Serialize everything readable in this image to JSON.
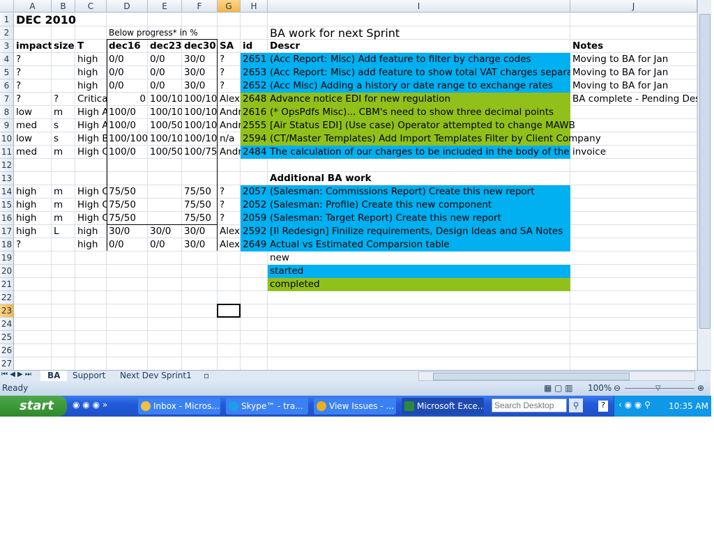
{
  "columns": [
    "A",
    "B",
    "C",
    "D",
    "E",
    "F",
    "G",
    "H",
    "I",
    "J"
  ],
  "selected_cell": "G23",
  "colors": {
    "started": "#00B0F0",
    "completed": "#92C01A",
    "new": "#FFFFFF"
  },
  "rows": {
    "1": {
      "A": "DEC 2010"
    },
    "2": {
      "D": "Below progress* in %",
      "I": "BA work for next Sprint"
    },
    "3": {
      "A": "impact",
      "B": "size",
      "C": "T",
      "D": "dec16",
      "E": "dec23",
      "F": "dec30",
      "G": "SA",
      "H": "id",
      "I": "Descr",
      "J": "Notes"
    },
    "4": {
      "A": "?",
      "C": "high",
      "D": "0/0",
      "E": "0/0",
      "F": "30/0",
      "G": "?",
      "H": "2651",
      "I": "(Acc Report: Misc) Add feature to filter by charge codes",
      "J": "Moving to BA for Jan",
      "status": "started"
    },
    "5": {
      "A": "?",
      "C": "high",
      "D": "0/0",
      "E": "0/0",
      "F": "30/0",
      "G": "?",
      "H": "2653",
      "I": "(Acc Report: Misc) add feature to show total VAT charges separat",
      "J": "Moving to BA for Jan",
      "status": "started"
    },
    "6": {
      "A": "?",
      "C": "high",
      "D": "0/0",
      "E": "0/0",
      "F": "30/0",
      "G": "?",
      "H": "2652",
      "I": "(Acc Misc) Adding a history or date range to exchange rates",
      "J": "Moving to BA for Jan",
      "status": "started"
    },
    "7": {
      "A": "?",
      "B": "?",
      "C": "Critical",
      "D": "0",
      "E": "100/10",
      "F": "100/10",
      "G": "Alex",
      "H": "2648",
      "I": "Advance notice EDI for new regulation",
      "J": "BA complete - Pending Des",
      "status": "completed"
    },
    "8": {
      "A": "low",
      "B": "m",
      "C": "High A",
      "D": "100/0",
      "E": "100/10",
      "F": "100/10",
      "G": "Andr",
      "H": "2616",
      "I": " (* OpsPdfs Misc)... CBM's need to show three decimal points",
      "status": "completed"
    },
    "9": {
      "A": "med",
      "B": "s",
      "C": "High A",
      "D": "100/0",
      "E": "100/50",
      "F": "100/10",
      "G": "Andr",
      "H": "2555",
      "I": "[Air Status EDI] (Use case) Operator attempted to change MAWB",
      "status": "completed"
    },
    "10": {
      "A": "low",
      "B": "s",
      "C": "High B",
      "D": "100/100",
      "E": "100/10",
      "F": "100/10",
      "G": "n/a",
      "H": "2594",
      "I": "(CT/Master Templates) Add Import Templates Filter by Client Company",
      "status": "completed"
    },
    "11": {
      "A": "med",
      "B": "m",
      "C": "High C",
      "D": "100/0",
      "E": "100/50",
      "F": "100/75",
      "G": "Andr",
      "H": "2484",
      "I": "The calculation of our charges to be included in the body of the invoice",
      "status": "started"
    },
    "13": {
      "I": "Additional BA work"
    },
    "14": {
      "A": "high",
      "B": "m",
      "C": "High C",
      "D": "75/50",
      "F": "75/50",
      "G": "?",
      "H": "2057",
      "I": "(Salesman: Commissions Report) Create this new report",
      "status": "started"
    },
    "15": {
      "A": "high",
      "B": "m",
      "C": "High C",
      "D": "75/50",
      "F": "75/50",
      "G": "?",
      "H": "2052",
      "I": "(Salesman: Profile) Create this new component",
      "status": "started"
    },
    "16": {
      "A": "high",
      "B": "m",
      "C": "High C",
      "D": "75/50",
      "F": "75/50",
      "G": "?",
      "H": "2059",
      "I": "(Salesman: Target Report) Create this new report",
      "status": "started"
    },
    "17": {
      "A": "high",
      "B": "L",
      "C": "high",
      "D": "30/0",
      "E": "30/0",
      "F": "30/0",
      "G": "Alex",
      "H": "2592",
      "I": "[II Redesign] Finilize requirements, Design Ideas and SA Notes",
      "status": "started"
    },
    "18": {
      "A": "?",
      "C": "high",
      "D": "0/0",
      "E": "0/0",
      "F": "30/0",
      "G": "Alex",
      "H": "2649",
      "I": "Actual vs Estimated Comparsion table",
      "status": "started"
    },
    "19": {
      "I": "new",
      "legend": "new"
    },
    "20": {
      "I": "started",
      "legend": "started"
    },
    "21": {
      "I": "completed",
      "legend": "completed"
    }
  },
  "sheet_tabs": [
    "BA",
    "Support",
    "Next Dev Sprint1"
  ],
  "active_tab": "BA",
  "status": {
    "ready": "Ready",
    "zoom": "100%"
  },
  "taskbar": {
    "start": "start",
    "tasks": [
      "Inbox - Micros...",
      "Skype™ - tra...",
      "View Issues - ...",
      "Microsoft Exce..."
    ],
    "active_task": "Microsoft Exce...",
    "search_placeholder": "Search Desktop",
    "clock": "10:35 AM"
  }
}
